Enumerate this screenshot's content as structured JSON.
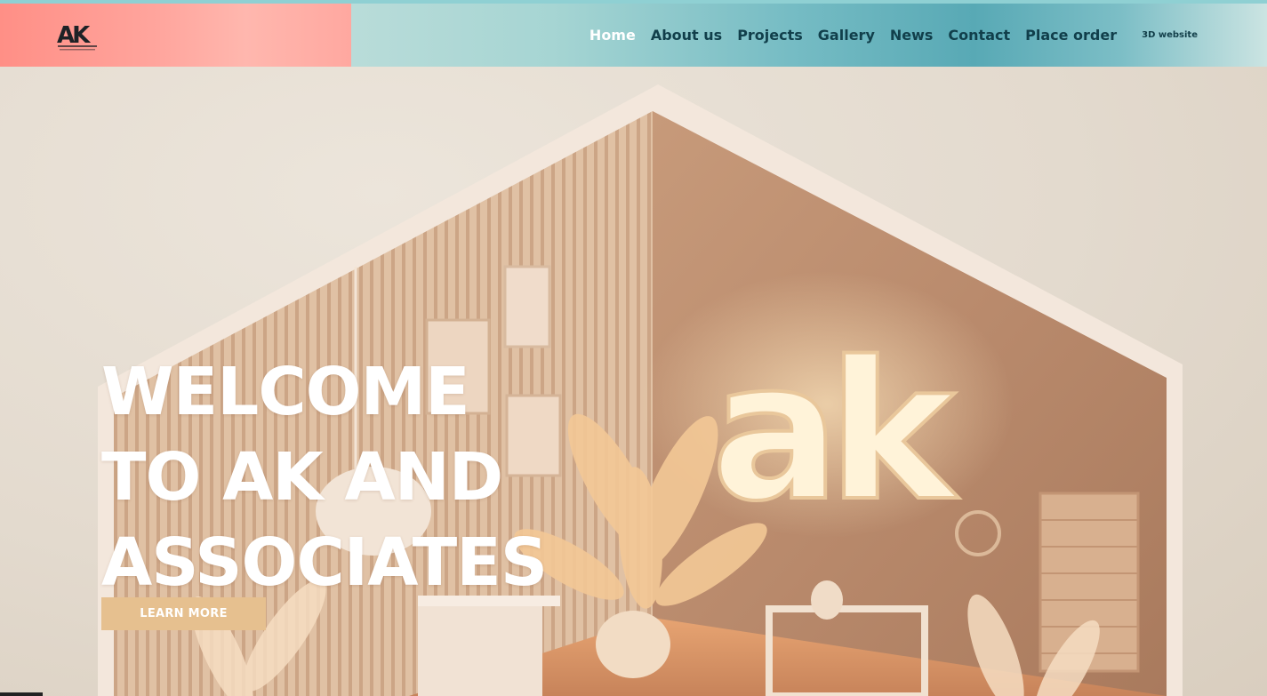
{
  "header": {
    "logo": {
      "text": "AK",
      "subtext": "AK AND ASSOCIATES"
    },
    "nav": {
      "items": [
        {
          "label": "Home",
          "active": true
        },
        {
          "label": "About us"
        },
        {
          "label": "Projects"
        },
        {
          "label": "Gallery"
        },
        {
          "label": "News"
        },
        {
          "label": "Contact"
        },
        {
          "label": "Place order"
        }
      ],
      "extra_link": "3D website"
    }
  },
  "hero": {
    "title_lines": [
      "WELCOME",
      "TO AK AND",
      "ASSOCIATES"
    ],
    "button_label": "LEARN MORE",
    "sign_text": "ak"
  },
  "colors": {
    "logo_panel": "#ff9d94",
    "nav_panel": "#6fb7c1",
    "nav_text": "#113f4b",
    "nav_active": "#ffffff",
    "button": "#e6c08f",
    "hero_bg": "#e3dace"
  }
}
